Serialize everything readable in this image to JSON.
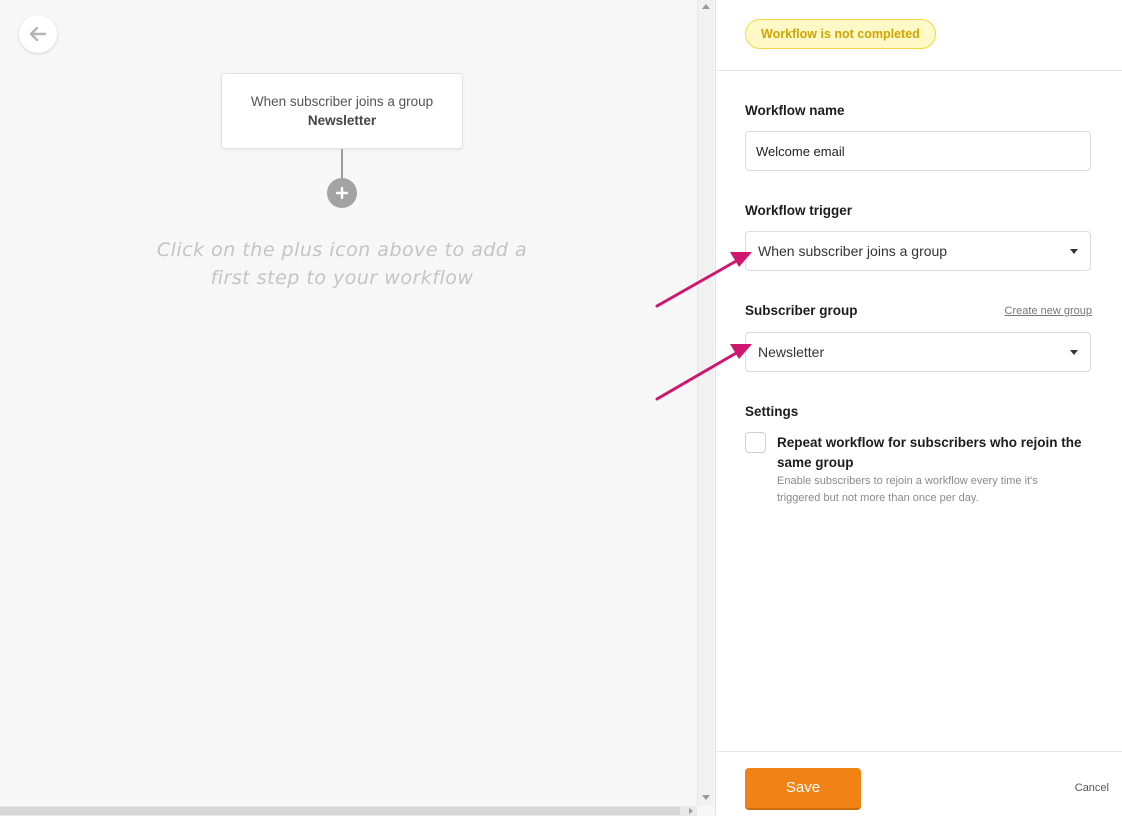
{
  "canvas": {
    "back_icon": "arrow-left-icon",
    "trigger_card": {
      "line1": "When subscriber joins a group",
      "line2": "Newsletter"
    },
    "plus_icon": "plus-icon",
    "hint": "Click on the plus icon above to add a first step to your workflow"
  },
  "panel": {
    "status_badge": "Workflow is not completed",
    "workflow_name": {
      "label": "Workflow name",
      "value": "Welcome email"
    },
    "workflow_trigger": {
      "label": "Workflow trigger",
      "value": "When subscriber joins a group"
    },
    "subscriber_group": {
      "label": "Subscriber group",
      "link": "Create new group",
      "value": "Newsletter"
    },
    "settings": {
      "label": "Settings",
      "checkbox_title": "Repeat workflow for subscribers who rejoin the same group",
      "checkbox_desc": "Enable subscribers to rejoin a workflow every time it's triggered but not more than once per day.",
      "checked": false
    },
    "footer": {
      "save": "Save",
      "cancel": "Cancel"
    }
  },
  "colors": {
    "accent_orange": "#f08313",
    "badge_yellow": "#fff9c7",
    "annotation_arrow": "#d0176f"
  }
}
